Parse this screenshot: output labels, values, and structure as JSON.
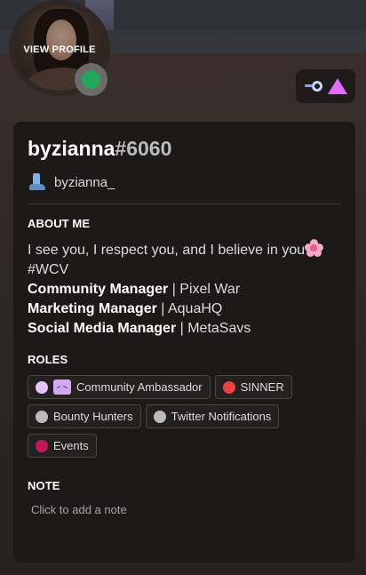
{
  "profile": {
    "view_profile_label": "VIEW PROFILE",
    "status": "online",
    "status_color": "#23a55a",
    "username": "byzianna",
    "discriminator": "#6060",
    "alt_name": "byzianna_",
    "alt_name_icon": "boot-icon"
  },
  "badges": [
    {
      "name": "hypesquad-icon"
    },
    {
      "name": "nitro-icon",
      "color": "#e46bff"
    }
  ],
  "about": {
    "title": "ABOUT ME",
    "line1": "I see you, I respect you, and I believe in you",
    "line1_emoji": "cherry-blossom-icon",
    "line2": "#WCV",
    "roles_list": [
      {
        "bold": "Community Manager",
        "rest": " | Pixel War"
      },
      {
        "bold": "Marketing Manager",
        "rest": " | AquaHQ"
      },
      {
        "bold": "Social Media Manager",
        "rest": " | MetaSavs"
      }
    ]
  },
  "roles": {
    "title": "ROLES",
    "items": [
      {
        "label": "Community Ambassador",
        "color": "#e3c6f5",
        "has_emoji": true
      },
      {
        "label": "SINNER",
        "color": "#ed4245"
      },
      {
        "label": "Bounty Hunters",
        "color": "#b9bbbe"
      },
      {
        "label": "Twitter Notifications",
        "color": "#b9bbbe"
      },
      {
        "label": "Events",
        "color": "#c2185b"
      }
    ]
  },
  "note": {
    "title": "NOTE",
    "placeholder": "Click to add a note"
  }
}
